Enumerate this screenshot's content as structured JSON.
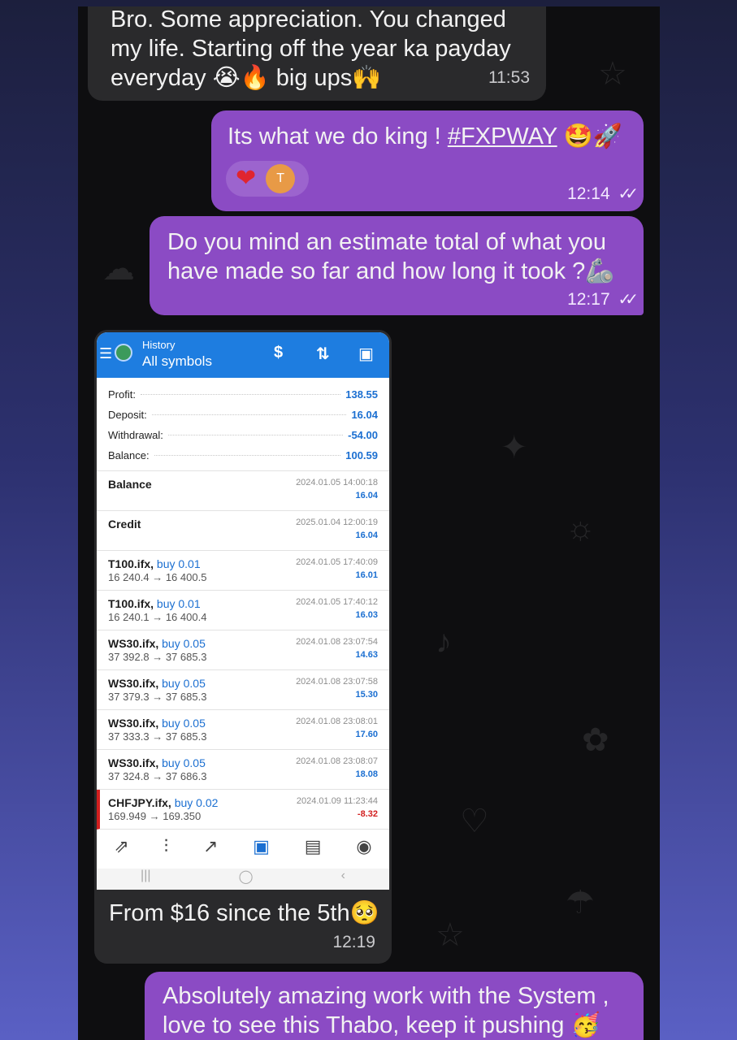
{
  "messages": {
    "m1": {
      "text": "Bro. Some appreciation. You changed my life. Starting off the year ka payday everyday 😭🔥 big ups🙌",
      "time": "11:53"
    },
    "m2": {
      "text_before": "Its what we do king ! ",
      "link": "#FXPWAY",
      "emoji": "🤩🚀",
      "time": "12:14",
      "reactions": [
        "❤",
        "T"
      ]
    },
    "m3": {
      "text": "Do you mind an estimate total of what you have made so far and how long it took ?🦾",
      "time": "12:17"
    },
    "m4": {
      "text": "From $16 since the 5th🥺",
      "time": "12:19"
    },
    "m5": {
      "text": "Absolutely amazing work with the System , love to see this Thabo, keep it pushing 🥳"
    }
  },
  "status_ticks": "✓✓",
  "screenshot": {
    "header": {
      "small": "History",
      "title": "All symbols"
    },
    "summary": [
      {
        "label": "Profit:",
        "value": "138.55"
      },
      {
        "label": "Deposit:",
        "value": "16.04"
      },
      {
        "label": "Withdrawal:",
        "value": "-54.00"
      },
      {
        "label": "Balance:",
        "value": "100.59"
      }
    ],
    "deals": [
      {
        "symbol": "Balance",
        "side": "",
        "prices": "",
        "time": "2024.01.05 14:00:18",
        "profit": "16.04"
      },
      {
        "symbol": "Credit",
        "side": "",
        "prices": "",
        "time": "2025.01.04 12:00:19",
        "profit": "16.04"
      },
      {
        "symbol": "T100.ifx,",
        "side": "buy 0.01",
        "prices": "16 240.4 → 16 400.5",
        "time": "2024.01.05 17:40:09",
        "profit": "16.01"
      },
      {
        "symbol": "T100.ifx,",
        "side": "buy 0.01",
        "prices": "16 240.1 → 16 400.4",
        "time": "2024.01.05 17:40:12",
        "profit": "16.03"
      },
      {
        "symbol": "WS30.ifx,",
        "side": "buy 0.05",
        "prices": "37 392.8 → 37 685.3",
        "time": "2024.01.08 23:07:54",
        "profit": "14.63"
      },
      {
        "symbol": "WS30.ifx,",
        "side": "buy 0.05",
        "prices": "37 379.3 → 37 685.3",
        "time": "2024.01.08 23:07:58",
        "profit": "15.30"
      },
      {
        "symbol": "WS30.ifx,",
        "side": "buy 0.05",
        "prices": "37 333.3 → 37 685.3",
        "time": "2024.01.08 23:08:01",
        "profit": "17.60"
      },
      {
        "symbol": "WS30.ifx,",
        "side": "buy 0.05",
        "prices": "37 324.8 → 37 686.3",
        "time": "2024.01.08 23:08:07",
        "profit": "18.08"
      },
      {
        "symbol": "CHFJPY.ifx,",
        "side": "buy 0.02",
        "prices": "169.949 → 169.350",
        "time": "2024.01.09 11:23:44",
        "profit": "-8.32"
      }
    ],
    "tab_icons": [
      "trade-arrows-icon",
      "candles-icon",
      "chart-icon",
      "history-icon",
      "news-icon",
      "chat-icon"
    ]
  },
  "colors": {
    "outgoing": "#8b4bc4",
    "incoming": "#2a2a2c",
    "accent": "#1e7de0",
    "negative": "#d21f1f"
  }
}
